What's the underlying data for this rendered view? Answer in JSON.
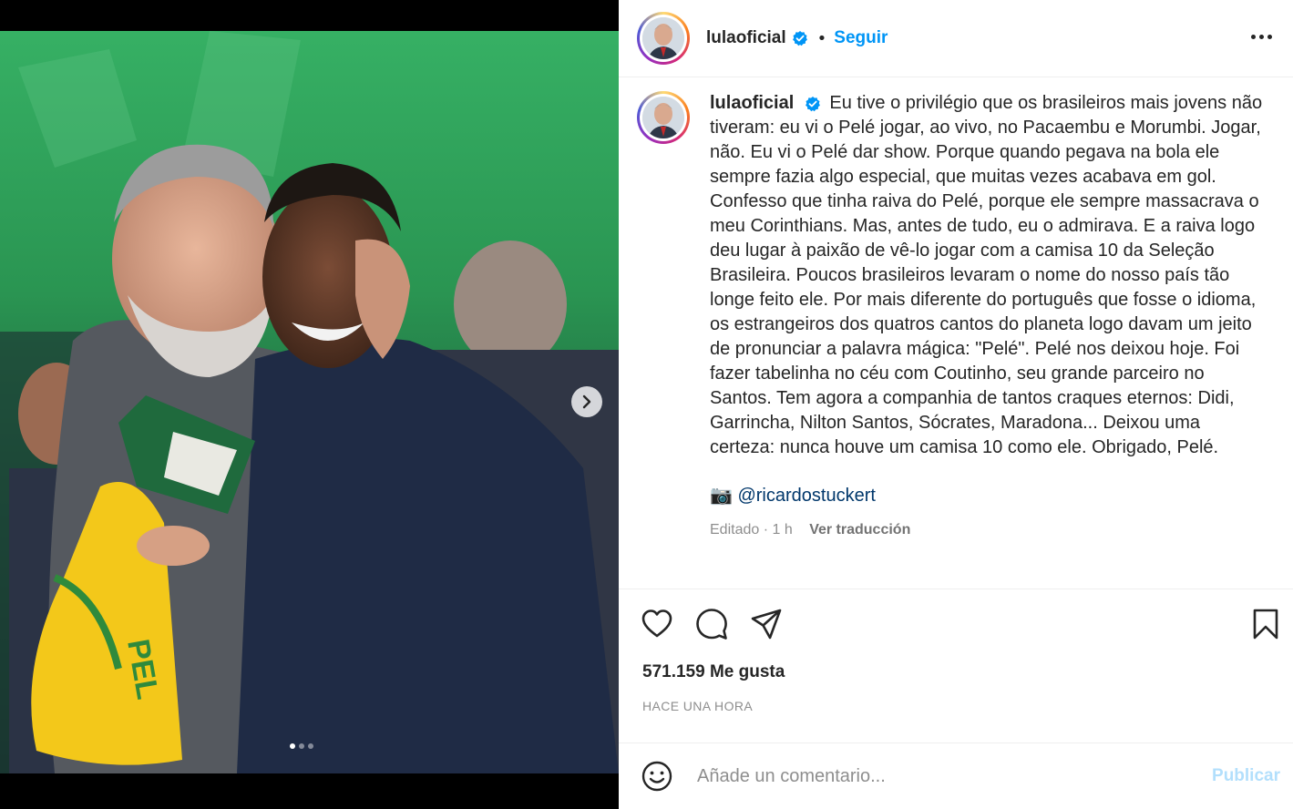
{
  "post": {
    "media": {
      "carousel_count": 3,
      "active_index": 0,
      "next_icon": "chevron-right-icon"
    },
    "header": {
      "username": "lulaoficial",
      "verified": true,
      "separator": "•",
      "follow_label": "Seguir",
      "more_icon": "more-options-icon"
    },
    "caption": {
      "username": "lulaoficial",
      "text": "Eu tive o privilégio que os brasileiros mais jovens não tiveram: eu vi o Pelé jogar, ao vivo, no Pacaembu e Morumbi. Jogar, não. Eu vi o Pelé dar show. Porque quando pegava na bola ele sempre fazia algo especial, que muitas vezes acabava em gol. Confesso que tinha raiva do Pelé, porque ele sempre massacrava o meu Corinthians. Mas, antes de tudo, eu o admirava. E a raiva logo deu lugar à paixão de vê-lo jogar com a camisa 10 da Seleção Brasileira. Poucos brasileiros levaram o nome do nosso país tão longe feito ele. Por mais diferente do português que fosse o idioma, os estrangeiros dos quatros cantos do planeta logo davam um jeito de pronunciar a palavra mágica: \"Pelé\". Pelé nos deixou hoje. Foi fazer tabelinha no céu com Coutinho, seu grande parceiro no Santos. Tem agora a companhia de tantos craques eternos: Didi, Garrincha, Nilton Santos, Sócrates, Maradona... Deixou uma certeza: nunca houve um camisa 10 como ele. Obrigado, Pelé.",
      "credit_emoji": "📷",
      "credit_handle": "@ricardostuckert",
      "edited_label": "Editado",
      "meta_sep": " · ",
      "time": "1 h",
      "translate_label": "Ver traducción"
    },
    "actions": {
      "like_icon": "heart-icon",
      "comment_icon": "comment-icon",
      "share_icon": "share-icon",
      "save_icon": "bookmark-icon"
    },
    "likes": "571.159 Me gusta",
    "time_ago": "HACE UNA HORA",
    "comment": {
      "placeholder": "Añade un comentario...",
      "value": "",
      "publish_label": "Publicar",
      "emoji_icon": "emoji-icon"
    }
  },
  "colors": {
    "accent": "#0095f6",
    "publish_disabled": "#b2dffc",
    "text": "#262626",
    "muted": "#8e8e8e",
    "link": "#00376b",
    "verified": "#0095f6"
  }
}
